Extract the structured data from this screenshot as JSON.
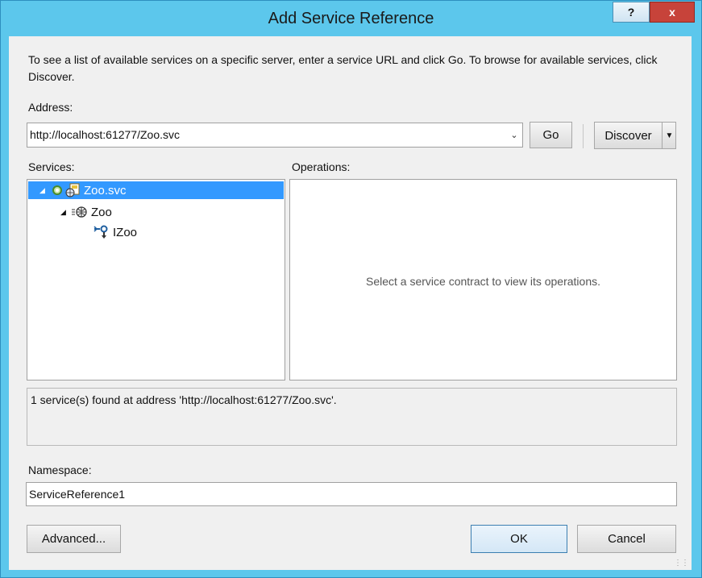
{
  "window": {
    "title": "Add Service Reference",
    "help_label": "?",
    "close_label": "x"
  },
  "instructions": "To see a list of available services on a specific server, enter a service URL and click Go. To browse for available services, click Discover.",
  "address": {
    "label": "Address:",
    "value": "http://localhost:61277/Zoo.svc"
  },
  "buttons": {
    "go": "Go",
    "discover": "Discover",
    "advanced": "Advanced...",
    "ok": "OK",
    "cancel": "Cancel"
  },
  "services": {
    "label": "Services:",
    "tree": [
      {
        "label": "Zoo.svc",
        "icon": "service-file-icon",
        "selected": true,
        "expanded": true
      },
      {
        "label": "Zoo",
        "icon": "service-globe-icon",
        "selected": false,
        "expanded": true
      },
      {
        "label": "IZoo",
        "icon": "contract-interface-icon",
        "selected": false,
        "expanded": false
      }
    ]
  },
  "operations": {
    "label": "Operations:",
    "empty_message": "Select a service contract to view its operations."
  },
  "status": "1 service(s) found at address 'http://localhost:61277/Zoo.svc'.",
  "namespace": {
    "label": "Namespace:",
    "value": "ServiceReference1"
  },
  "colors": {
    "title_bar": "#5cc7ec",
    "close_button": "#c7433a",
    "selection": "#3399ff",
    "dialog_background": "#f0f0f0"
  }
}
